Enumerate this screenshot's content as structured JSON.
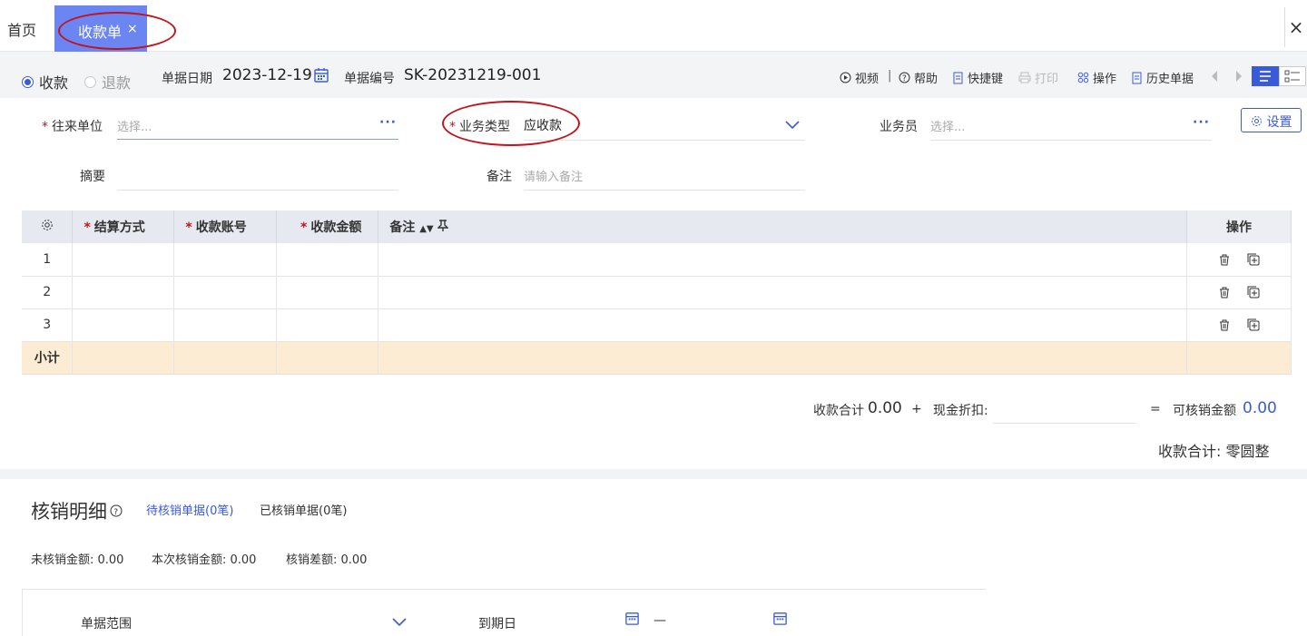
{
  "tabs": {
    "home": "首页",
    "active": "收款单",
    "close": "×",
    "window_close": "×"
  },
  "toolbar": {
    "radio_receive": "收款",
    "radio_refund": "退款",
    "date_label": "单据日期",
    "date_value": "2023-12-19",
    "no_label": "单据编号",
    "no_value": "SK-20231219-001",
    "video": "视频",
    "help": "帮助",
    "shortcut": "快捷键",
    "print": "打印",
    "operate": "操作",
    "history": "历史单据"
  },
  "form": {
    "partner_label": "往来单位",
    "partner_placeholder": "选择...",
    "type_label": "业务类型",
    "type_value": "应收款",
    "staff_label": "业务员",
    "staff_placeholder": "选择...",
    "settings": "设置",
    "summary_label": "摘要",
    "remark_label": "备注",
    "remark_placeholder": "请输入备注",
    "required_mark": "*"
  },
  "grid": {
    "headers": {
      "method": "结算方式",
      "account": "收款账号",
      "amount": "收款金额",
      "remark": "备注",
      "ops": "操作"
    },
    "rows": [
      "1",
      "2",
      "3"
    ],
    "subtotal": "小计"
  },
  "totals": {
    "sum_label": "收款合计",
    "sum_value": "0.00",
    "plus": "+",
    "discount_label": "现金折扣:",
    "equals": "=",
    "writeoff_label": "可核销金额",
    "writeoff_value": "0.00",
    "sum_caps": "收款合计: 零圆整"
  },
  "writeoff": {
    "title": "核销明细",
    "tab_pending": "待核销单据(0笔)",
    "tab_done": "已核销单据(0笔)",
    "unwritten": "未核销金额: 0.00",
    "current": "本次核销金额: 0.00",
    "diff": "核销差额: 0.00",
    "range_label": "单据范围",
    "due_label": "到期日",
    "dash": "—"
  },
  "colors": {
    "accent": "#3a5bd9",
    "tab_bg": "#6b86f2",
    "required": "#c0151f",
    "subtotal_bg": "#fcecd3"
  }
}
